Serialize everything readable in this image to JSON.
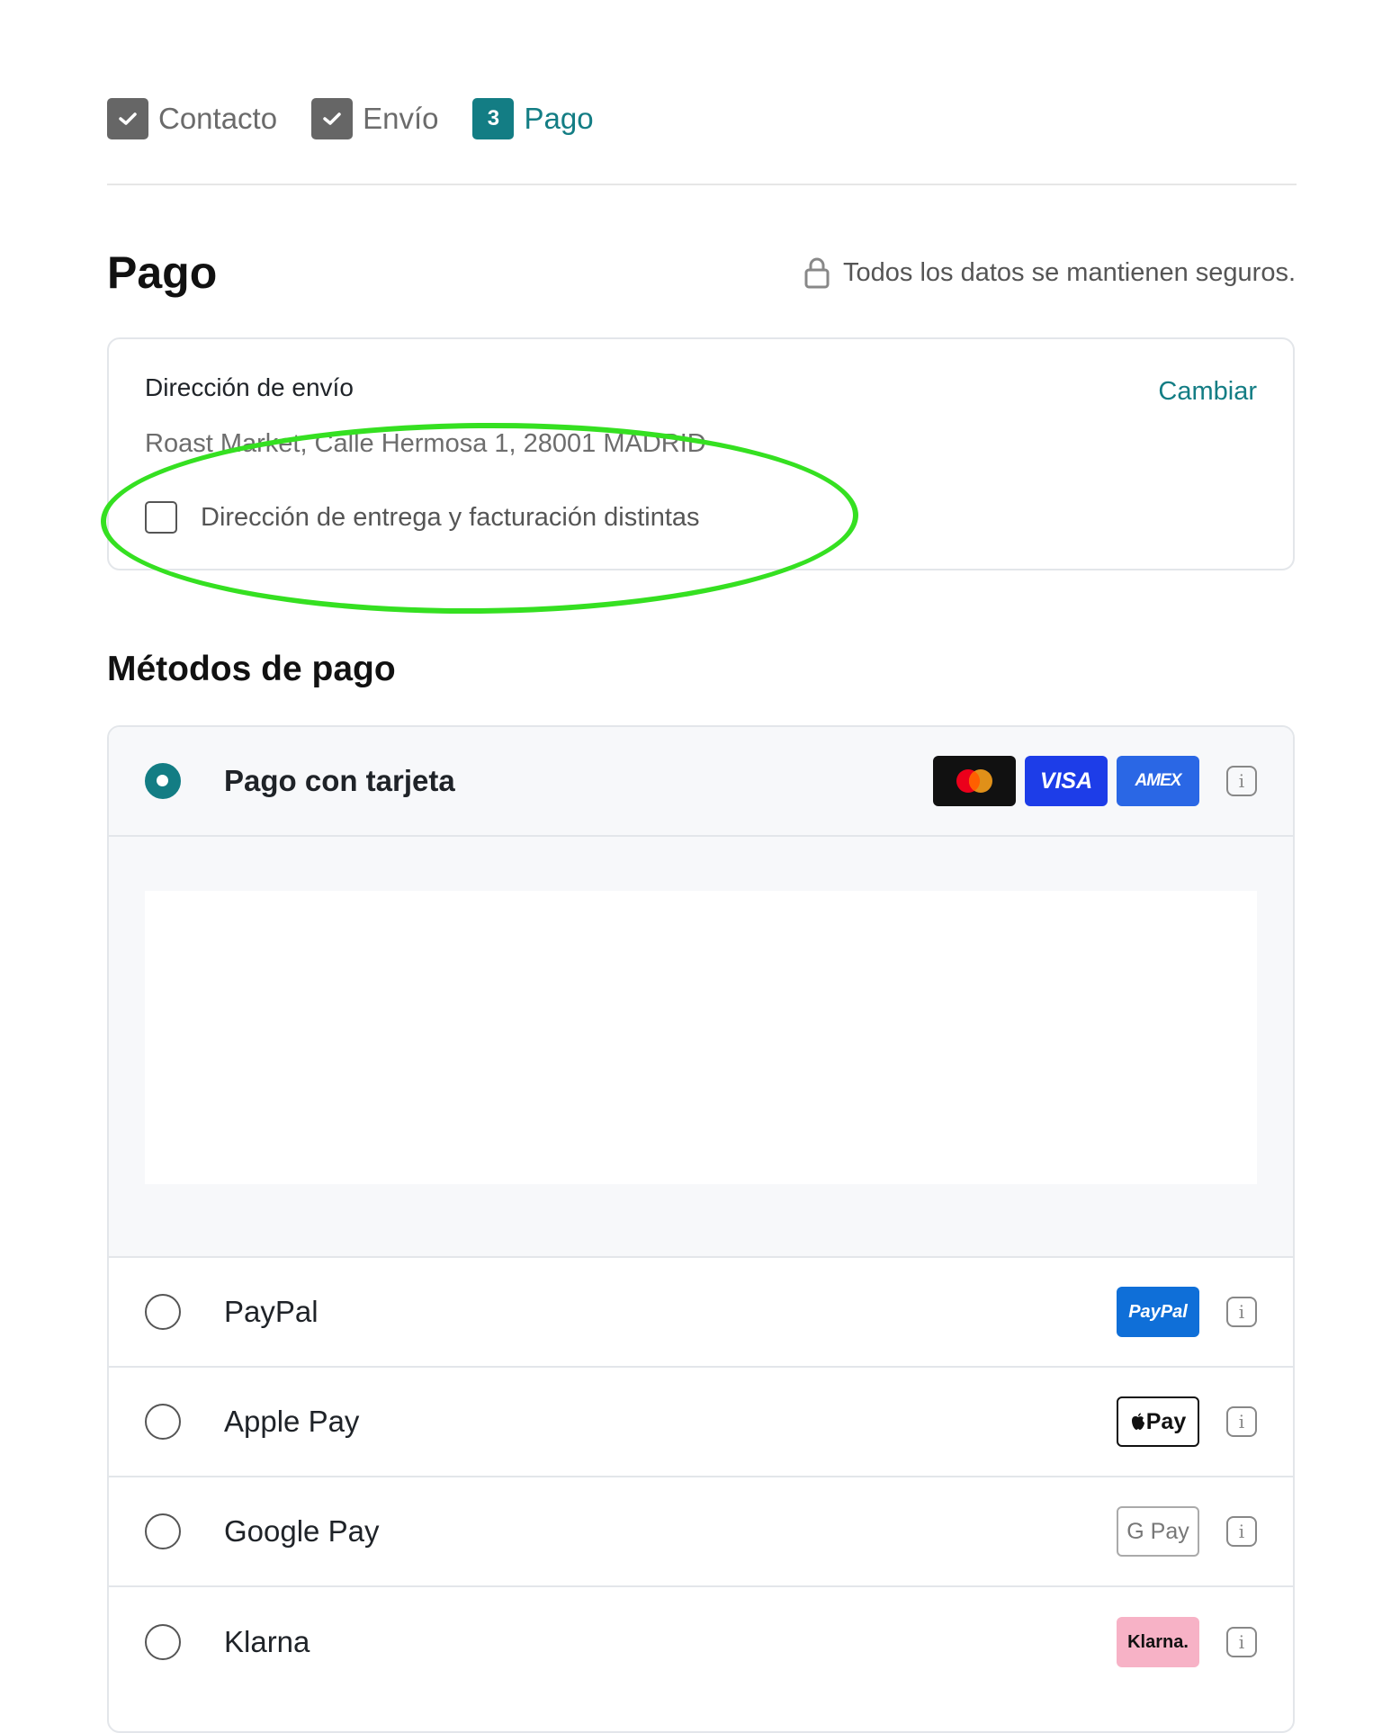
{
  "stepper": {
    "steps": [
      {
        "number": "",
        "label": "Contacto",
        "state": "done"
      },
      {
        "number": "",
        "label": "Envío",
        "state": "done"
      },
      {
        "number": "3",
        "label": "Pago",
        "state": "active"
      }
    ]
  },
  "page": {
    "title": "Pago",
    "secure_note": "Todos los datos se mantienen seguros."
  },
  "shipping": {
    "title": "Dirección de envío",
    "change_label": "Cambiar",
    "address": "Roast Market, Calle Hermosa 1, 28001 MADRID",
    "different_billing_label": "Dirección de entrega y facturación distintas",
    "different_billing_checked": false
  },
  "payment": {
    "title": "Métodos de pago",
    "methods": [
      {
        "label": "Pago con tarjeta",
        "selected": true,
        "logos": [
          "mastercard",
          "VISA",
          "AMEX"
        ]
      },
      {
        "label": "PayPal",
        "selected": false,
        "logos": [
          "PayPal"
        ]
      },
      {
        "label": "Apple Pay",
        "selected": false,
        "logos": [
          "Pay"
        ]
      },
      {
        "label": "Google Pay",
        "selected": false,
        "logos": [
          "G Pay"
        ]
      },
      {
        "label": "Klarna",
        "selected": false,
        "logos": [
          "Klarna."
        ]
      }
    ],
    "info_icon": "i"
  },
  "colors": {
    "accent": "#137d84",
    "highlight": "#35e021"
  }
}
